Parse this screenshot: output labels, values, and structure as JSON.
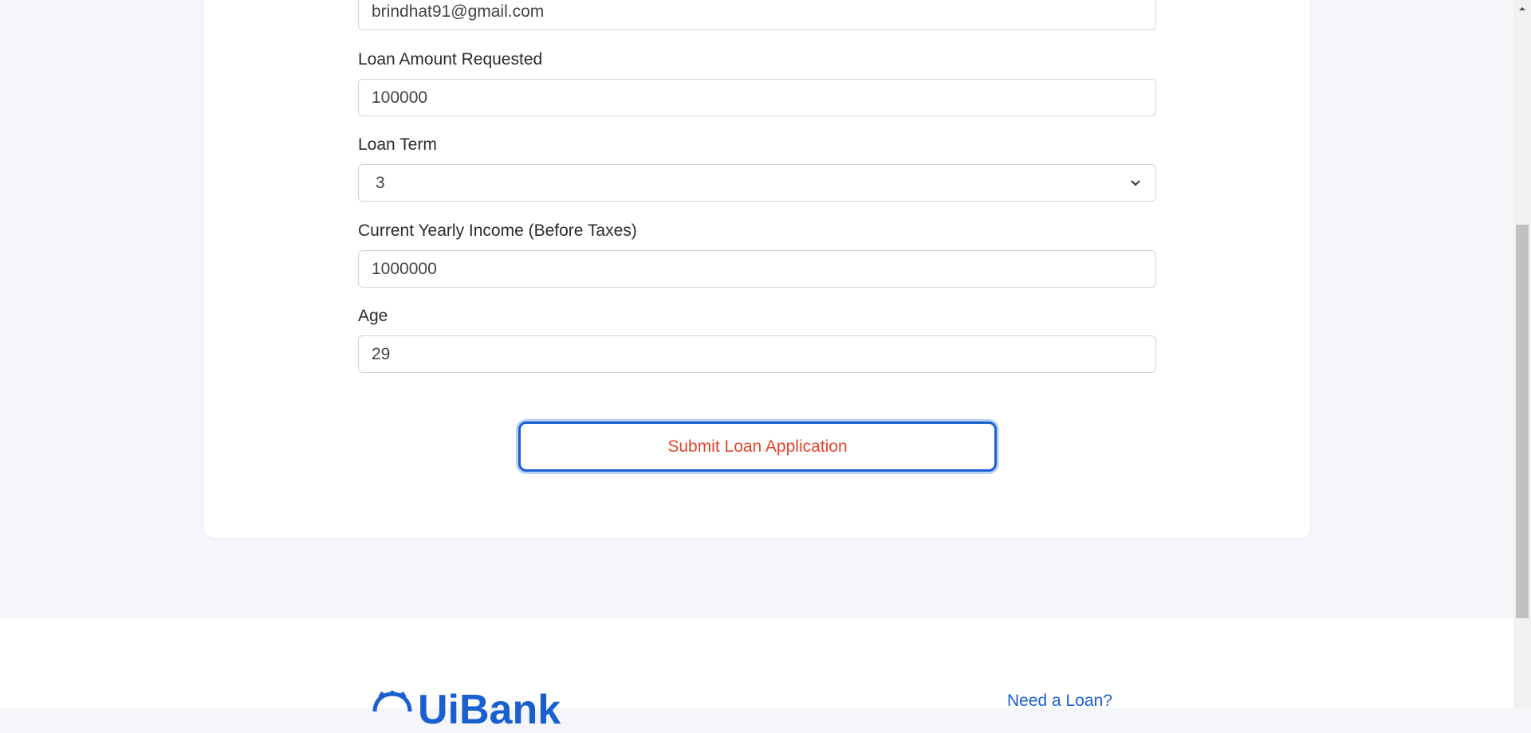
{
  "form": {
    "email": {
      "value": "brindhat91@gmail.com"
    },
    "loan_amount": {
      "label": "Loan Amount Requested",
      "value": "100000"
    },
    "loan_term": {
      "label": "Loan Term",
      "selected": "3"
    },
    "yearly_income": {
      "label": "Current Yearly Income (Before Taxes)",
      "value": "1000000"
    },
    "age": {
      "label": "Age",
      "value": "29"
    },
    "submit_label": "Submit Loan Application"
  },
  "footer": {
    "logo_text": "UiBank",
    "link_need_loan": "Need a Loan?"
  },
  "colors": {
    "accent": "#1a5fd0",
    "submit_text": "#e2452b",
    "page_bg": "#f4f6fa"
  },
  "icons": [
    "chevron-down-icon",
    "scroll-up-arrow-icon",
    "logo-icon"
  ]
}
